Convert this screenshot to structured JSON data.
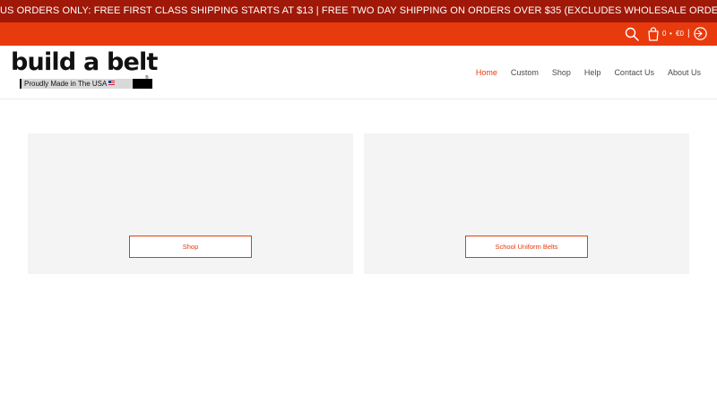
{
  "announcement": {
    "text": "US ORDERS ONLY: FREE FIRST CLASS SHIPPING STARTS AT $13 | FREE TWO DAY SHIPPING ON ORDERS OVER $35 (EXCLUDES WHOLESALE ORDERS)"
  },
  "utility": {
    "cart_count": "0",
    "separator_dot": "•",
    "cart_total": "€0",
    "divider": "|",
    "icons": [
      "search-icon",
      "cart-icon",
      "account-icon"
    ]
  },
  "logo": {
    "wordmark": "build a belt",
    "tagline": "Proudly Made in The USA",
    "registered": "®"
  },
  "nav": {
    "items": [
      {
        "label": "Home",
        "active": true
      },
      {
        "label": "Custom",
        "active": false
      },
      {
        "label": "Shop",
        "active": false
      },
      {
        "label": "Help",
        "active": false
      },
      {
        "label": "Contact Us",
        "active": false
      },
      {
        "label": "About Us",
        "active": false
      }
    ]
  },
  "collections": [
    {
      "button_label": "Shop"
    },
    {
      "button_label": "School Uniform Belts"
    }
  ],
  "colors": {
    "announcement_bg": "#a01808",
    "utility_bg": "#e83a0d",
    "accent": "#e83a0d",
    "card_bg": "#f4f4f5"
  }
}
